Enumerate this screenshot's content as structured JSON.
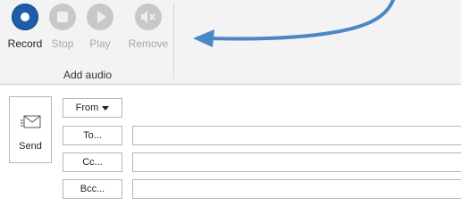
{
  "ribbon": {
    "buttons": {
      "record": "Record",
      "stop": "Stop",
      "play": "Play",
      "remove": "Remove"
    },
    "group_label": "Add audio"
  },
  "compose": {
    "send_label": "Send",
    "from_label": "From",
    "to_label": "To...",
    "cc_label": "Cc...",
    "bcc_label": "Bcc...",
    "to_value": "",
    "cc_value": "",
    "bcc_value": ""
  },
  "colors": {
    "record_blue": "#1e5ea8",
    "annotation_arrow": "#4a86c8"
  },
  "icons": {
    "record": "record-icon",
    "stop": "stop-icon",
    "play": "play-icon",
    "remove": "speaker-mute-icon",
    "send": "envelope-icon",
    "from_dropdown": "caret-down-icon"
  }
}
